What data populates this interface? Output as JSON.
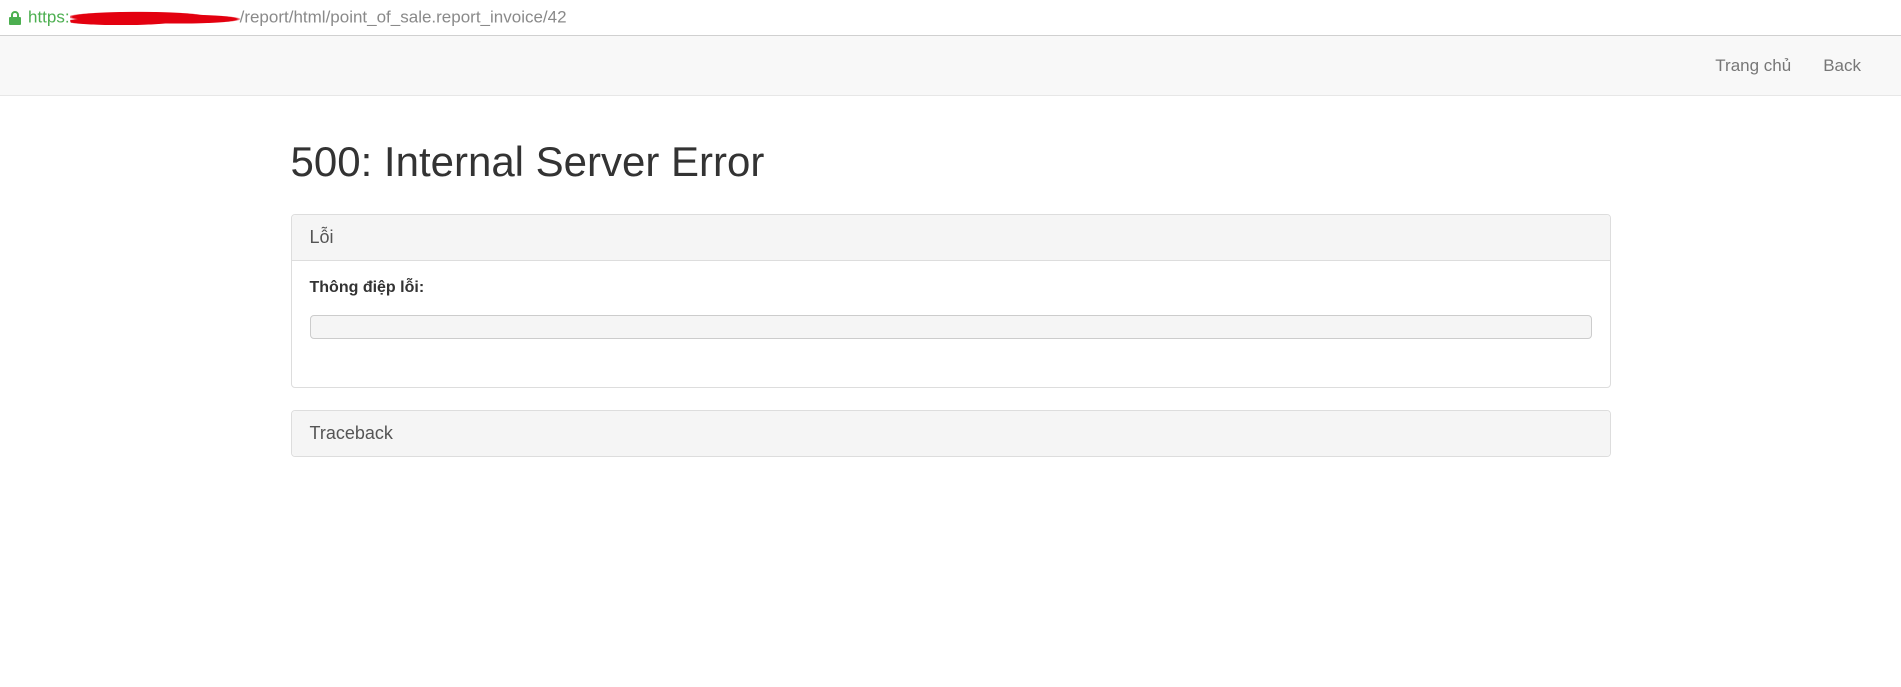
{
  "address_bar": {
    "protocol": "https",
    "path": "/report/html/point_of_sale.report_invoice/42"
  },
  "nav": {
    "home_label": "Trang chủ",
    "back_label": "Back"
  },
  "page_title": "500: Internal Server Error",
  "error_panel": {
    "heading": "Lỗi",
    "message_label": "Thông điệp lỗi:",
    "message_value": ""
  },
  "traceback_panel": {
    "heading": "Traceback"
  }
}
